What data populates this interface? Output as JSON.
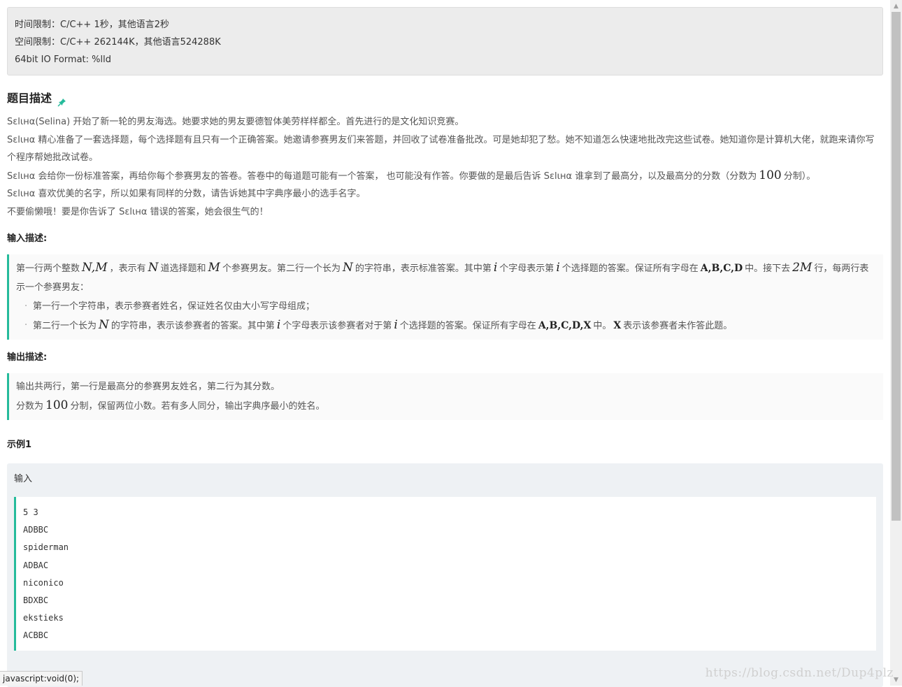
{
  "limits": {
    "time": "时间限制：C/C++ 1秒，其他语言2秒",
    "space": "空间限制：C/C++ 262144K，其他语言524288K",
    "io": "64bit IO Format: %lld"
  },
  "description": {
    "title": "题目描述",
    "lines": [
      "Sεlιнα(Selina) 开始了新一轮的男友海选。她要求她的男友要德智体美劳样样都全。首先进行的是文化知识竞赛。",
      "Sεlιнα 精心准备了一套选择题，每个选择题有且只有一个正确答案。她邀请参赛男友们来答题，并回收了试卷准备批改。可是她却犯了愁。她不知道怎么快速地批改完这些试卷。她知道你是计算机大佬，就跑来请你写个程序帮她批改试卷。"
    ],
    "line3_pre": "Sεlιнα 会给你一份标准答案，再给你每个参赛男友的答卷。答卷中的每道题可能有一个答案， 也可能没有作答。你要做的是最后告诉 Sεlιнα 谁拿到了最高分，以及最高分的分数（分数为",
    "line3_math": "100",
    "line3_post": "分制）。",
    "line4": "Sεlιнα 喜欢优美的名字，所以如果有同样的分数，请告诉她其中字典序最小的选手名字。",
    "line5": "不要偷懒哦！要是你告诉了 Sεlιнα 错误的答案，她会很生气的！"
  },
  "input": {
    "title": "输入描述:",
    "t1": "第一行两个整数",
    "m1": "N,M",
    "t2": "，表示有",
    "m2": "N",
    "t3": "道选择题和",
    "m3": "M",
    "t4": "个参赛男友。第二行一个长为",
    "m4": "N",
    "t5": "的字符串，表示标准答案。其中第",
    "m5": "i",
    "t6": "个字母表示第",
    "m6": "i",
    "t7": "个选择题的答案。保证所有字母在",
    "m7": "A,B,C,D",
    "t8": "中。接下去",
    "m8": "2M",
    "t9": "行，每两行表示一个参赛男友：",
    "b1": "第一行一个字符串，表示参赛者姓名，保证姓名仅由大小写字母组成；",
    "b2_1": "第二行一个长为",
    "b2_m1": "N",
    "b2_2": "的字符串，表示该参赛者的答案。其中第",
    "b2_m2": "i",
    "b2_3": "个字母表示该参赛者对于第",
    "b2_m3": "i",
    "b2_4": "个选择题的答案。保证所有字母在",
    "b2_m4": "A,B,C,D,X",
    "b2_5": "中。",
    "b2_m5": "X",
    "b2_6": "表示该参赛者未作答此题。"
  },
  "output": {
    "title": "输出描述:",
    "line1": "输出共两行，第一行是最高分的参赛男友姓名，第二行为其分数。",
    "line2_pre": "分数为",
    "line2_math": "100",
    "line2_post": "分制，保留两位小数。若有多人同分，输出字典序最小的姓名。"
  },
  "example": {
    "title": "示例1",
    "input_label": "输入",
    "lines": [
      "5 3",
      "ADBBC",
      "spiderman",
      "ADBAC",
      "niconico",
      "BDXBC",
      "ekstieks",
      "ACBBC"
    ]
  },
  "statusbar": "javascript:void(0);",
  "watermark": "https://blog.csdn.net/Dup4plz",
  "colors": {
    "accent": "#25bb9b",
    "limits_bg": "#ececec",
    "example_bg": "#eef1f4"
  }
}
